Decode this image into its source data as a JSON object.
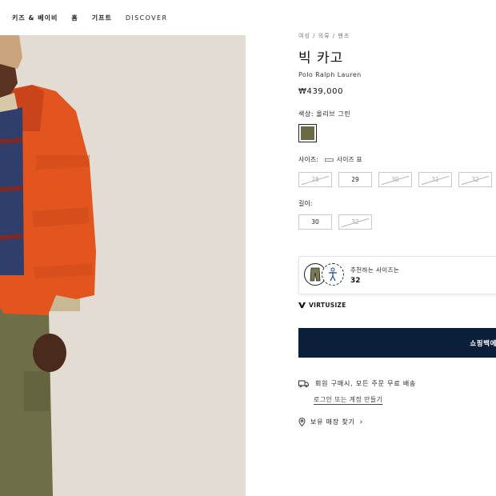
{
  "nav": {
    "items": [
      "키즈 & 베이비",
      "홈",
      "기프트",
      "DISCOVER"
    ]
  },
  "product": {
    "breadcrumb": "여성 / 의류 / 팬츠",
    "title": "빅 카고",
    "brand": "Polo Ralph Lauren",
    "price": "₩439,000",
    "color_label": "색상: 올리브 그린",
    "swatch_color": "#6b6a45",
    "size_label": "사이즈:",
    "size_chart_label": "사이즈 표",
    "sizes": [
      {
        "label": "28",
        "available": false
      },
      {
        "label": "29",
        "available": true
      },
      {
        "label": "30",
        "available": false
      },
      {
        "label": "31",
        "available": false
      },
      {
        "label": "32",
        "available": false
      }
    ],
    "length_label": "길이:",
    "lengths": [
      {
        "label": "30",
        "available": true
      },
      {
        "label": "32",
        "available": false
      }
    ]
  },
  "recommendation": {
    "label": "추천하는 사이즈는",
    "value": "32",
    "widget_brand": "VIRTUSIZE"
  },
  "cart": {
    "button_label": "쇼핑백에"
  },
  "shipping": {
    "text": "회원 구매시, 모든 주문 무료 배송",
    "link": "로그인 또는 계정 만들기"
  },
  "store": {
    "label": "보유 매장 찾기"
  },
  "colors": {
    "accent": "#0b1f3a"
  }
}
